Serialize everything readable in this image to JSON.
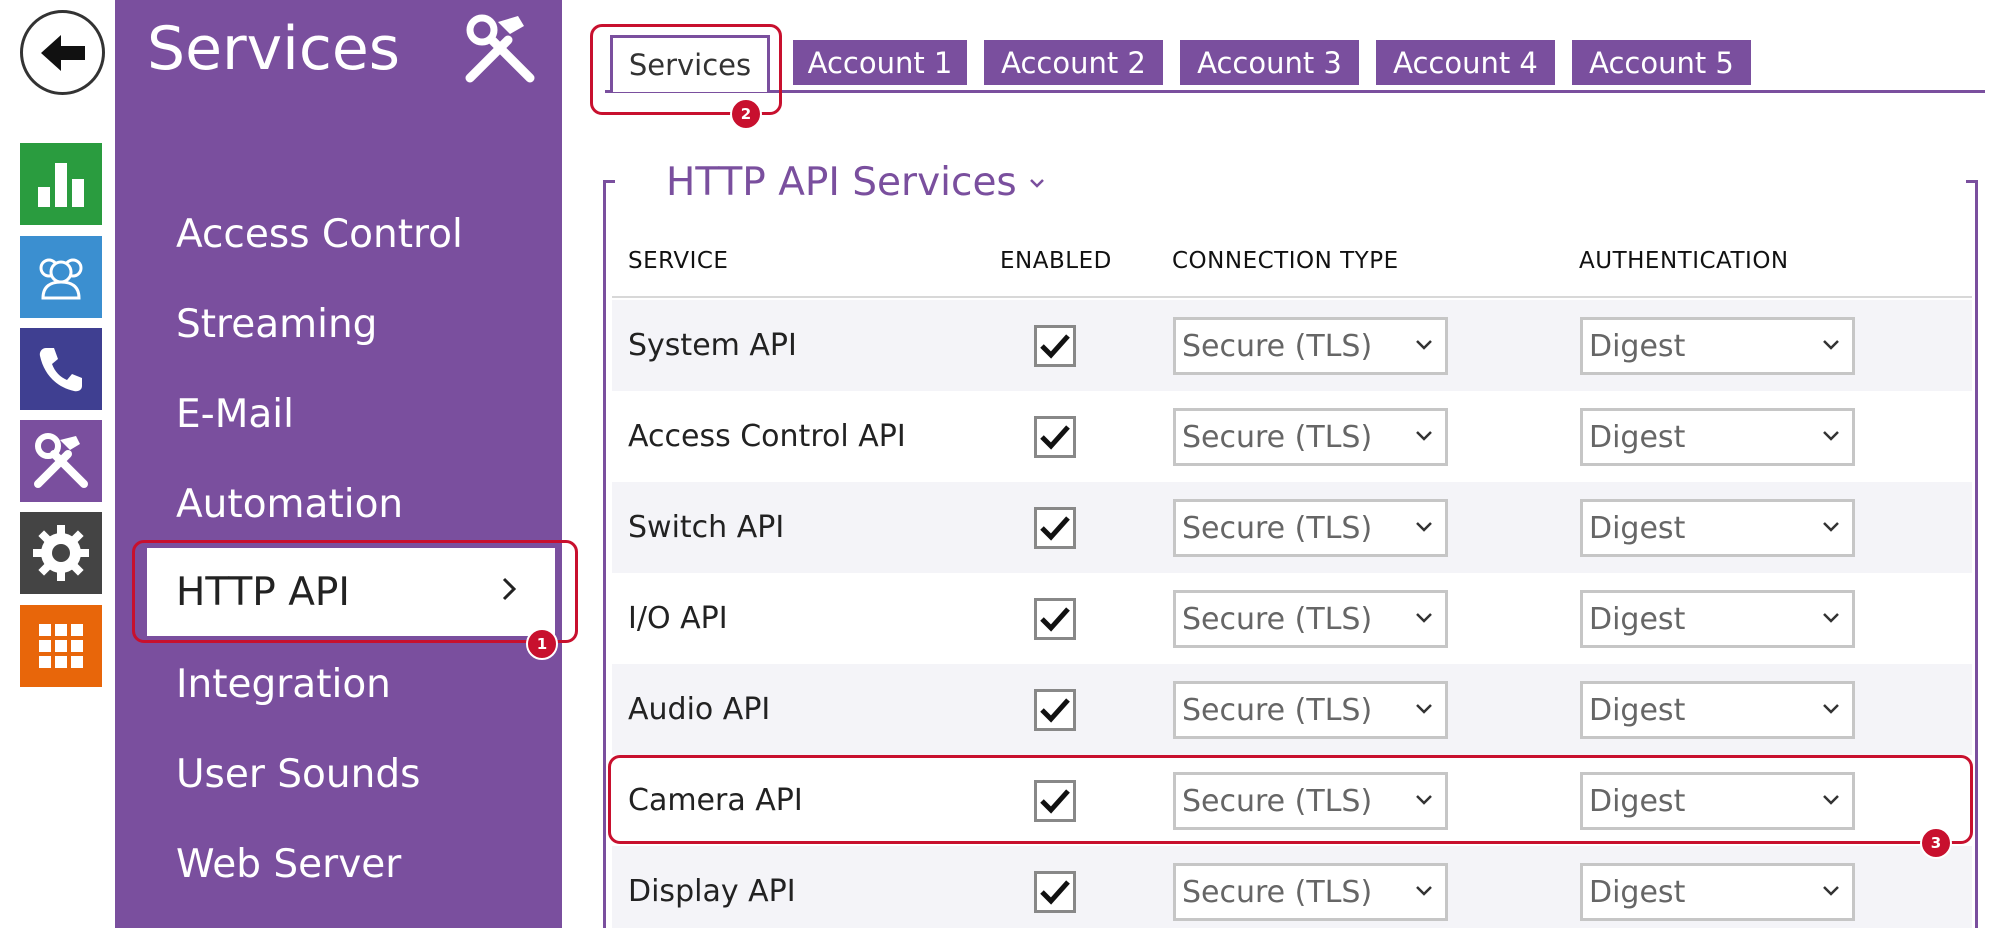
{
  "sidebar": {
    "title": "Services",
    "items": [
      {
        "label": "Access Control"
      },
      {
        "label": "Streaming"
      },
      {
        "label": "E-Mail"
      },
      {
        "label": "Automation"
      },
      {
        "label": "HTTP API",
        "active": true
      },
      {
        "label": "Integration"
      },
      {
        "label": "User Sounds"
      },
      {
        "label": "Web Server"
      }
    ]
  },
  "rail": {
    "icons": [
      "back-arrow-icon",
      "status-chart-icon",
      "directory-users-icon",
      "phone-icon",
      "services-tools-icon",
      "settings-gear-icon",
      "grid-apps-icon"
    ],
    "colors": {
      "status": "#2a9c3f",
      "directory": "#3b8fd0",
      "phone": "#3f3f91",
      "services": "#7a4f9e",
      "settings": "#444444",
      "grid": "#e8660a"
    }
  },
  "tabs": [
    {
      "label": "Services",
      "active": true
    },
    {
      "label": "Account 1"
    },
    {
      "label": "Account 2"
    },
    {
      "label": "Account 3"
    },
    {
      "label": "Account 4"
    },
    {
      "label": "Account 5"
    }
  ],
  "section": {
    "title": "HTTP API Services"
  },
  "table": {
    "headers": {
      "service": "SERVICE",
      "enabled": "ENABLED",
      "connection": "CONNECTION TYPE",
      "auth": "AUTHENTICATION"
    },
    "rows": [
      {
        "service": "System API",
        "enabled": true,
        "connection": "Secure (TLS)",
        "auth": "Digest"
      },
      {
        "service": "Access Control API",
        "enabled": true,
        "connection": "Secure (TLS)",
        "auth": "Digest"
      },
      {
        "service": "Switch API",
        "enabled": true,
        "connection": "Secure (TLS)",
        "auth": "Digest"
      },
      {
        "service": "I/O API",
        "enabled": true,
        "connection": "Secure (TLS)",
        "auth": "Digest"
      },
      {
        "service": "Audio API",
        "enabled": true,
        "connection": "Secure (TLS)",
        "auth": "Digest"
      },
      {
        "service": "Camera API",
        "enabled": true,
        "connection": "Secure (TLS)",
        "auth": "Digest"
      },
      {
        "service": "Display API",
        "enabled": true,
        "connection": "Secure (TLS)",
        "auth": "Digest"
      }
    ]
  },
  "callouts": [
    "1",
    "2",
    "3"
  ],
  "colors": {
    "accent": "#7a4f9e",
    "highlight": "#c8102e"
  }
}
